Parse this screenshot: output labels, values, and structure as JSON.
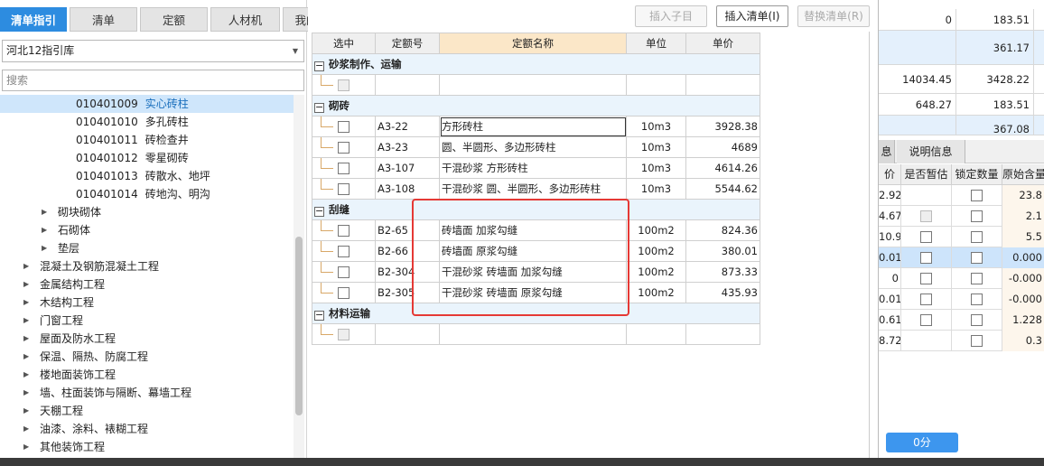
{
  "tabs": [
    "清单指引",
    "清单",
    "定额",
    "人材机",
    "我的数据"
  ],
  "library_select": "河北12指引库",
  "search_placeholder": "搜索",
  "tree": [
    {
      "code": "010401009",
      "text": "实心砖柱",
      "level": 3,
      "selected": true
    },
    {
      "code": "010401010",
      "text": "多孔砖柱",
      "level": 3
    },
    {
      "code": "010401011",
      "text": "砖检查井",
      "level": 3
    },
    {
      "code": "010401012",
      "text": "零星砌砖",
      "level": 3
    },
    {
      "code": "010401013",
      "text": "砖散水、地坪",
      "level": 3
    },
    {
      "code": "010401014",
      "text": "砖地沟、明沟",
      "level": 3
    },
    {
      "code": "",
      "text": "砌块砌体",
      "level": 2
    },
    {
      "code": "",
      "text": "石砌体",
      "level": 2
    },
    {
      "code": "",
      "text": "垫层",
      "level": 2
    },
    {
      "code": "",
      "text": "混凝土及钢筋混凝土工程",
      "level": 1
    },
    {
      "code": "",
      "text": "金属结构工程",
      "level": 1
    },
    {
      "code": "",
      "text": "木结构工程",
      "level": 1
    },
    {
      "code": "",
      "text": "门窗工程",
      "level": 1
    },
    {
      "code": "",
      "text": "屋面及防水工程",
      "level": 1
    },
    {
      "code": "",
      "text": "保温、隔热、防腐工程",
      "level": 1
    },
    {
      "code": "",
      "text": "楼地面装饰工程",
      "level": 1
    },
    {
      "code": "",
      "text": "墙、柱面装饰与隔断、幕墙工程",
      "level": 1
    },
    {
      "code": "",
      "text": "天棚工程",
      "level": 1
    },
    {
      "code": "",
      "text": "油漆、涂料、裱糊工程",
      "level": 1
    },
    {
      "code": "",
      "text": "其他装饰工程",
      "level": 1
    }
  ],
  "toolbar": {
    "insert_child": "插入子目",
    "insert_list": "插入清单(I)",
    "replace_list": "替换清单(R)"
  },
  "grid": {
    "headers": [
      "选中",
      "定额号",
      "定额名称",
      "单位",
      "单价"
    ],
    "groups": [
      {
        "title": "砂浆制作、运输",
        "rows": [
          {
            "empty": true
          }
        ]
      },
      {
        "title": "砌砖",
        "rows": [
          {
            "code": "A3-22",
            "name": "方形砖柱",
            "unit": "10m3",
            "price": "3928.38",
            "boxed": true
          },
          {
            "code": "A3-23",
            "name": "圆、半圆形、多边形砖柱",
            "unit": "10m3",
            "price": "4689"
          },
          {
            "code": "A3-107",
            "name": "干混砂浆 方形砖柱",
            "unit": "10m3",
            "price": "4614.26"
          },
          {
            "code": "A3-108",
            "name": "干混砂浆 圆、半圆形、多边形砖柱",
            "unit": "10m3",
            "price": "5544.62"
          }
        ]
      },
      {
        "title": "刮缝",
        "rows": [
          {
            "code": "B2-65",
            "name": "砖墙面 加浆勾缝",
            "unit": "100m2",
            "price": "824.36"
          },
          {
            "code": "B2-66",
            "name": "砖墙面 原浆勾缝",
            "unit": "100m2",
            "price": "380.01"
          },
          {
            "code": "B2-304",
            "name": "干混砂浆 砖墙面 加浆勾缝",
            "unit": "100m2",
            "price": "873.33"
          },
          {
            "code": "B2-305",
            "name": "干混砂浆 砖墙面 原浆勾缝",
            "unit": "100m2",
            "price": "435.93"
          }
        ]
      },
      {
        "title": "材料运输",
        "rows": [
          {
            "empty": true
          }
        ]
      }
    ]
  },
  "right_top": [
    {
      "a": "0",
      "b": "183.51"
    },
    {
      "a": "",
      "b": "361.17"
    },
    {
      "a": "14034.45",
      "b": "3428.22"
    },
    {
      "a": "648.27",
      "b": "183.51"
    },
    {
      "a": "",
      "b": "367.08"
    }
  ],
  "right_tabs": [
    "息",
    "说明信息"
  ],
  "right_headers": [
    "价",
    "是否暂估",
    "锁定数量",
    "原始含量"
  ],
  "right_rows": [
    {
      "price": "2.92",
      "est_disabled": false,
      "est_visible": false,
      "orig": "23.8"
    },
    {
      "price": "4.67",
      "est_disabled": true,
      "est_visible": true,
      "orig": "2.1"
    },
    {
      "price": "10.9",
      "est_disabled": false,
      "est_visible": true,
      "orig": "5.5"
    },
    {
      "price": "0.01",
      "est_disabled": false,
      "est_visible": true,
      "orig": "0.000",
      "selected": true
    },
    {
      "price": "0",
      "est_disabled": false,
      "est_visible": true,
      "orig": "-0.000"
    },
    {
      "price": "0.01",
      "est_disabled": false,
      "est_visible": true,
      "orig": "-0.000"
    },
    {
      "price": "0.61",
      "est_disabled": false,
      "est_visible": true,
      "orig": "1.228"
    },
    {
      "price": "8.72",
      "est_disabled": false,
      "est_visible": false,
      "orig": "0.3"
    }
  ],
  "score_button": "0分",
  "colors": {
    "accent": "#2d8ce0",
    "highlight_box": "#e53935",
    "selected_row": "#cfe6fb"
  }
}
